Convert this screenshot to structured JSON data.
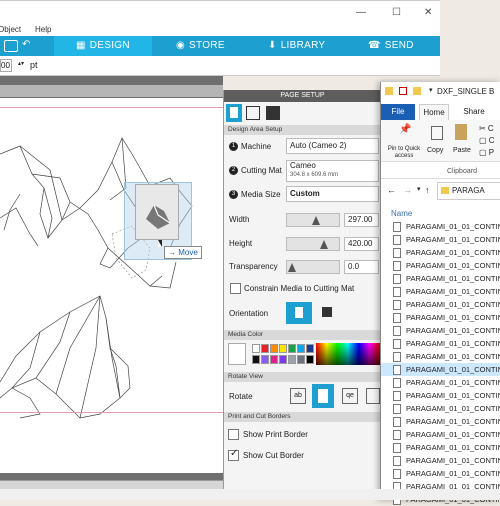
{
  "menubar": {
    "object_label": "Object",
    "help_label": "Help"
  },
  "window_controls": {
    "minimize": "—",
    "maximize": "☐",
    "close": "✕"
  },
  "nav": {
    "tabs": [
      {
        "label": "DESIGN",
        "icon": "grid-icon",
        "active": true
      },
      {
        "label": "STORE",
        "icon": "store-icon",
        "active": false
      },
      {
        "label": "LIBRARY",
        "icon": "library-icon",
        "active": false
      },
      {
        "label": "SEND",
        "icon": "send-icon",
        "active": false
      }
    ]
  },
  "toolbar": {
    "value": "00",
    "unit": "pt"
  },
  "canvas": {
    "move_tooltip": "Move"
  },
  "page_setup": {
    "title": "PAGE SETUP",
    "design_area_label": "Design Area Setup",
    "machine_label": "Machine",
    "machine_value": "Auto (Cameo 2)",
    "cutting_mat_label": "Cutting Mat",
    "cutting_mat_value": "Cameo",
    "cutting_mat_size": "304.8 x 609.6 mm",
    "media_size_label": "Media Size",
    "media_size_value": "Custom",
    "width_label": "Width",
    "width_value": "297.00",
    "height_label": "Height",
    "height_value": "420.00",
    "transparency_label": "Transparency",
    "transparency_value": "0.0",
    "constrain_label": "Constrain Media to Cutting Mat",
    "orientation_label": "Orientation",
    "media_color_label": "Media Color",
    "rotate_view_label": "Rotate View",
    "rotate_label": "Rotate",
    "print_cut_label": "Print and Cut Borders",
    "show_print_border": "Show Print Border",
    "show_cut_border": "Show Cut Border"
  },
  "swatches": [
    "#ffffff",
    "#e8202a",
    "#ff8c00",
    "#ffe600",
    "#16a34a",
    "#0ea5e9",
    "#1e3a8a",
    "#111111",
    "#8b5cf6",
    "#e0218a",
    "#7c3aed",
    "#9ca3af",
    "#6b7280",
    "#000000"
  ],
  "explorer": {
    "title": "DXF_SINGLE B",
    "tab_file": "File",
    "tab_home": "Home",
    "tab_share": "Share",
    "pin_label": "Pin to Quick access",
    "copy_label": "Copy",
    "paste_label": "Paste",
    "clipboard_label": "Clipboard",
    "address": "PARAGA",
    "name_header": "Name",
    "files": [
      "PARAGAMI_01_01_CONTINU",
      "PARAGAMI_01_01_CONTINU",
      "PARAGAMI_01_01_CONTINU",
      "PARAGAMI_01_01_CONTINU",
      "PARAGAMI_01_01_CONTINU",
      "PARAGAMI_01_01_CONTINU",
      "PARAGAMI_01_01_CONTINU",
      "PARAGAMI_01_01_CONTINU",
      "PARAGAMI_01_01_CONTINU",
      "PARAGAMI_01_01_CONTINU",
      "PARAGAMI_01_01_CONTINU",
      "PARAGAMI_01_01_CONTINU",
      "PARAGAMI_01_01_CONTINU",
      "PARAGAMI_01_01_CONTINU",
      "PARAGAMI_01_01_CONTINU",
      "PARAGAMI_01_01_CONTINU",
      "PARAGAMI_01_01_CONTINU",
      "PARAGAMI_01_01_CONTINU",
      "PARAGAMI_01_01_CONTINU",
      "PARAGAMI_01_01_CONTINU",
      "PARAGAMI_01_01_CONTINU",
      "PARAGAMI_01_01_CONTINU"
    ],
    "selected_index": 11
  }
}
